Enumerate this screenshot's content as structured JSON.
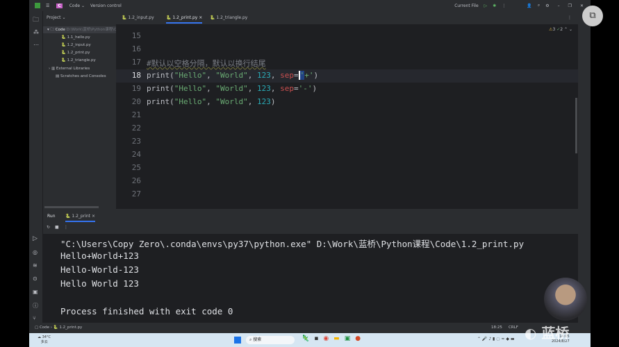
{
  "titlebar": {
    "project": "Code",
    "vcs": "Version control",
    "run_config": "Current File"
  },
  "project_panel": {
    "title": "Project",
    "root": "Code",
    "root_path": "D:\\Work\\蓝桥\\Python课程\\Code",
    "files": [
      "1.1_hello.py",
      "1.2_input.py",
      "1.2_print.py",
      "1.2_triangle.py"
    ],
    "external": "External Libraries",
    "scratches": "Scratches and Consoles"
  },
  "tabs": [
    {
      "label": "1.2_input.py"
    },
    {
      "label": "1.2_print.py",
      "active": true
    },
    {
      "label": "1.2_triangle.py"
    }
  ],
  "inspections": {
    "warnings": "3",
    "weak": "2"
  },
  "editor": {
    "line_numbers": [
      "15",
      "16",
      "17",
      "18",
      "19",
      "20",
      "21",
      "22",
      "23",
      "24",
      "25",
      "26",
      "27"
    ],
    "comment": "#默认以空格分隔，默认以换行结尾",
    "current_line": "18"
  },
  "run": {
    "tab_label": "Run",
    "config": "1.2_print",
    "output": [
      "\"C:\\Users\\Copy Zero\\.conda\\envs\\py37\\python.exe\" D:\\Work\\蓝桥\\Python课程\\Code\\1.2_print.py",
      "Hello+World+123",
      "Hello-World-123",
      "Hello World 123",
      "",
      "Process finished with exit code 0"
    ]
  },
  "status": {
    "breadcrumb_root": "Code",
    "breadcrumb_file": "1.2_print.py",
    "position": "18:25",
    "line_ending": "CRLF"
  },
  "taskbar": {
    "weather_temp": "34°C",
    "weather_desc": "多云",
    "search_placeholder": "搜索",
    "time": "14:05",
    "date": "2024/8/27",
    "watermark": "蓝桥"
  },
  "colors": {
    "accent": "#3574f0",
    "string": "#6aab73",
    "number": "#2aacb8",
    "run_green": "#5fb865"
  }
}
